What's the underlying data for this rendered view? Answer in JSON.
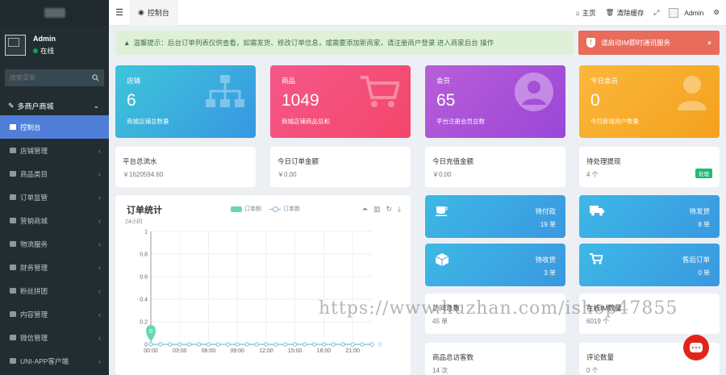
{
  "sidebar": {
    "user_name": "Admin",
    "status": "在线",
    "search_placeholder": "搜索菜单",
    "group_title": "多商户商城",
    "items": [
      {
        "label": "控制台",
        "active": true
      },
      {
        "label": "店铺管理"
      },
      {
        "label": "商品类目"
      },
      {
        "label": "订单监管"
      },
      {
        "label": "营销商城"
      },
      {
        "label": "物流服务"
      },
      {
        "label": "财务管理"
      },
      {
        "label": "粉丝拼团"
      },
      {
        "label": "内容管理"
      },
      {
        "label": "微信管理"
      },
      {
        "label": "UNI-APP客户端"
      }
    ]
  },
  "topbar": {
    "tab_label": "控制台",
    "home": "主页",
    "clear_cache": "清除缓存",
    "user": "Admin"
  },
  "alert": {
    "text": "温馨提示：后台订单列表仅供查看，如需发货、修改订单信息，或需要添加新商家，请注册商户登录 进入商家后台 操作"
  },
  "red_alert": {
    "text": "请启动IM即时通讯服务"
  },
  "stats": [
    {
      "label": "店铺",
      "value": "6",
      "desc": "商城店铺总数量",
      "color": "#3aaee0"
    },
    {
      "label": "商品",
      "value": "1049",
      "desc": "商城店铺商品总和",
      "color": "#f4507a"
    },
    {
      "label": "会员",
      "value": "65",
      "desc": "平台注册会员总数",
      "color": "#a852d8"
    },
    {
      "label": "今日会员",
      "value": "0",
      "desc": "今日新增用户数量",
      "color": "#f8ac2a"
    }
  ],
  "cards_row2": [
    {
      "title": "平台总流水",
      "value": "￥1620594.60"
    },
    {
      "title": "今日订单金额",
      "value": "￥0.00"
    },
    {
      "title": "今日充值金额",
      "value": "￥0.00"
    },
    {
      "title": "待处理提现",
      "value": "4 个",
      "badge": "处理"
    }
  ],
  "chart": {
    "title": "订单统计",
    "sub": "24小时",
    "legend_a": "订单额",
    "legend_b": "订单数",
    "marker_value": "0"
  },
  "chart_data": {
    "type": "line",
    "x": [
      "00:00",
      "01:00",
      "02:00",
      "03:00",
      "04:00",
      "05:00",
      "06:00",
      "07:00",
      "08:00",
      "09:00",
      "10:00",
      "11:00",
      "12:00",
      "13:00",
      "14:00",
      "15:00",
      "16:00",
      "17:00",
      "18:00",
      "19:00",
      "20:00",
      "21:00",
      "22:00",
      "23:00"
    ],
    "x_ticks": [
      "00:00",
      "03:00",
      "06:00",
      "09:00",
      "12:00",
      "15:00",
      "18:00",
      "21:00"
    ],
    "y_ticks": [
      "0",
      "0.2",
      "0.4",
      "0.6",
      "0.8",
      "1"
    ],
    "ylim": [
      0,
      1
    ],
    "series": [
      {
        "name": "订单额",
        "values": [
          0,
          0,
          0,
          0,
          0,
          0,
          0,
          0,
          0,
          0,
          0,
          0,
          0,
          0,
          0,
          0,
          0,
          0,
          0,
          0,
          0,
          0,
          0,
          0
        ]
      },
      {
        "name": "订单数",
        "values": [
          0,
          0,
          0,
          0,
          0,
          0,
          0,
          0,
          0,
          0,
          0,
          0,
          0,
          0,
          0,
          0,
          0,
          0,
          0,
          0,
          0,
          0,
          0,
          0
        ]
      }
    ],
    "right_axis_value": "0",
    "grid": true
  },
  "order_cards": [
    {
      "label": "待付款",
      "value": "19 单"
    },
    {
      "label": "待发货",
      "value": "8 单"
    },
    {
      "label": "待收货",
      "value": "3 单"
    },
    {
      "label": "售后订单",
      "value": "0 单"
    }
  ],
  "cards_bottom": [
    {
      "title": "访问总数",
      "value": "45 单"
    },
    {
      "title": "在线IM数量",
      "value": "6019 个"
    },
    {
      "title": "商品总访客数",
      "value": "14 次"
    },
    {
      "title": "评论数量",
      "value": "0 个"
    }
  ],
  "watermark": "https://www.huzhan.com/ishop47855",
  "colors": {
    "sidebar": "#222d32",
    "active": "#4f7fd9",
    "green": "#21b978"
  }
}
